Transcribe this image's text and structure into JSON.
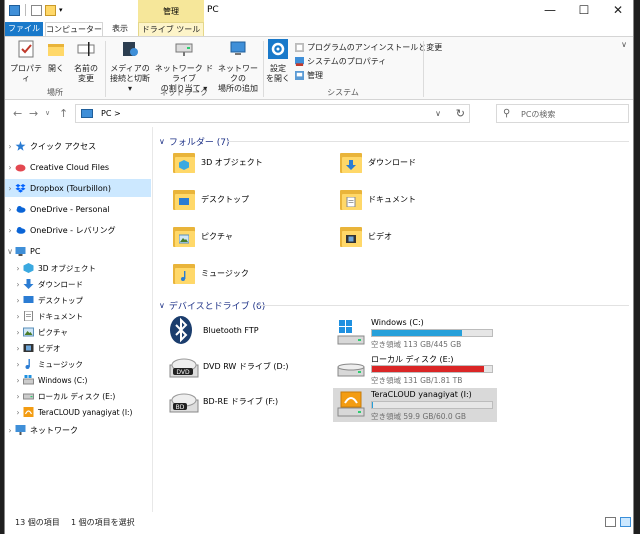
{
  "window": {
    "title": "PC",
    "context_tab_group": "管理",
    "minimize": "—",
    "maximize": "☐",
    "close": "✕"
  },
  "ribbon_tabs": [
    "ファイル",
    "コンピューター",
    "表示",
    "ドライブ ツール"
  ],
  "ribbon": {
    "location_group": {
      "label": "場所",
      "properties": "プロパティ",
      "open": "開く",
      "rename": [
        "名前の",
        "変更"
      ]
    },
    "network_group": {
      "label": "ネットワーク",
      "media": [
        "メディアの",
        "接続と切断 ▾"
      ],
      "map_drive": [
        "ネットワーク ドライブ",
        "の割り当て ▾"
      ],
      "add_location": [
        "ネットワークの",
        "場所の追加"
      ]
    },
    "system_group": {
      "label": "システム",
      "open_settings": [
        "設定",
        "を開く"
      ],
      "uninstall": "プログラムのアンインストールと変更",
      "system_properties": "システムのプロパティ",
      "manage": "管理"
    }
  },
  "address": {
    "crumb": "PC  >",
    "search_placeholder": "PCの検索"
  },
  "nav_pane": {
    "items": [
      {
        "label": "クイック アクセス",
        "icon": "star-icon",
        "color": "#2b7cd3"
      },
      {
        "label": "Creative Cloud Files",
        "icon": "creative-cloud-icon",
        "color": "#e34850"
      },
      {
        "label": "Dropbox (Tourbillon)",
        "icon": "dropbox-icon",
        "color": "#0061fe"
      },
      {
        "label": "OneDrive - Personal",
        "icon": "onedrive-icon",
        "color": "#0a64d6"
      },
      {
        "label": "OneDrive - レバリング",
        "icon": "onedrive-icon",
        "color": "#0a64d6"
      },
      {
        "label": "PC",
        "icon": "pc-icon",
        "color": "#3f8fd8"
      }
    ],
    "pc_children": [
      {
        "label": "3D オブジェクト",
        "icon": "3d-objects-icon"
      },
      {
        "label": "ダウンロード",
        "icon": "download-icon"
      },
      {
        "label": "デスクトップ",
        "icon": "desktop-icon"
      },
      {
        "label": "ドキュメント",
        "icon": "documents-icon"
      },
      {
        "label": "ピクチャ",
        "icon": "pictures-icon"
      },
      {
        "label": "ビデオ",
        "icon": "videos-icon"
      },
      {
        "label": "ミュージック",
        "icon": "music-icon"
      },
      {
        "label": "Windows (C:)",
        "icon": "windows-drive-icon"
      },
      {
        "label": "ローカル ディスク (E:)",
        "icon": "drive-icon"
      },
      {
        "label": "TeraCLOUD yanagiyat (I:)",
        "icon": "teracloud-icon"
      }
    ],
    "network": "ネットワーク"
  },
  "content": {
    "folders_header": "フォルダー (7)",
    "folders": [
      {
        "label": "3D オブジェクト",
        "icon": "3d-objects-icon"
      },
      {
        "label": "ダウンロード",
        "icon": "download-icon"
      },
      {
        "label": "デスクトップ",
        "icon": "desktop-icon"
      },
      {
        "label": "ドキュメント",
        "icon": "documents-icon"
      },
      {
        "label": "ピクチャ",
        "icon": "pictures-icon"
      },
      {
        "label": "ビデオ",
        "icon": "videos-icon"
      },
      {
        "label": "ミュージック",
        "icon": "music-icon"
      }
    ],
    "drives_header": "デバイスとドライブ (6)",
    "devices": [
      {
        "label": "Bluetooth FTP",
        "icon": "bluetooth-icon"
      },
      {
        "label": "DVD RW ドライブ (D:)",
        "icon": "dvd-drive-icon",
        "badge": "DVD"
      },
      {
        "label": "BD-RE ドライブ (F:)",
        "icon": "bd-drive-icon",
        "badge": "BD"
      }
    ],
    "drives": [
      {
        "name": "Windows (C:)",
        "free": "空き領域 113 GB/445 GB",
        "used_fraction": 0.75,
        "bar_color": "#26a0da",
        "icon": "windows-drive-icon"
      },
      {
        "name": "ローカル ディスク (E:)",
        "free": "空き領域 131 GB/1.81 TB",
        "used_fraction": 0.93,
        "bar_color": "#da2626",
        "icon": "drive-icon"
      },
      {
        "name": "TeraCLOUD yanagiyat (I:)",
        "free": "空き領域 59.9 GB/60.0 GB",
        "used_fraction": 0.002,
        "bar_color": "#26a0da",
        "icon": "teracloud-icon"
      }
    ]
  },
  "status": {
    "count": "13 個の項目",
    "selected": "1 個の項目を選択"
  }
}
